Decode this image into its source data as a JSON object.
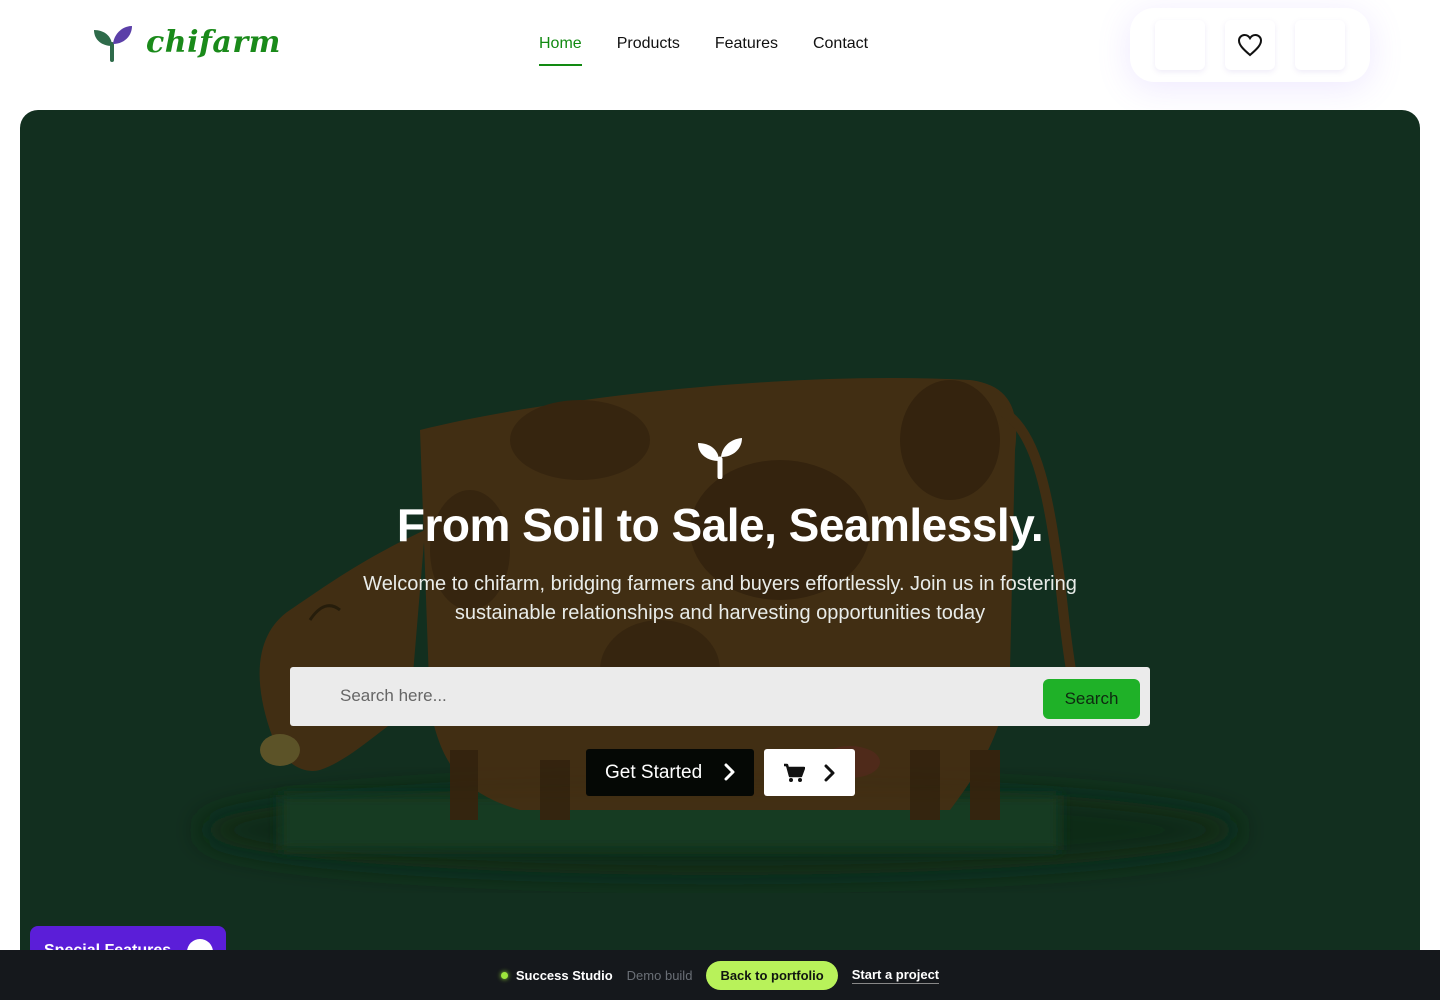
{
  "header": {
    "brand": "chifarm",
    "nav": [
      {
        "label": "Home",
        "active": true
      },
      {
        "label": "Products",
        "active": false
      },
      {
        "label": "Features",
        "active": false
      },
      {
        "label": "Contact",
        "active": false
      }
    ],
    "icons": [
      "blank-icon",
      "heart-icon",
      "blank-icon"
    ]
  },
  "hero": {
    "title": "From Soil to Sale, Seamlessly.",
    "subtitle": "Welcome to chifarm, bridging farmers and buyers effortlessly. Join us in fostering sustainable relationships and harvesting opportunities today",
    "search": {
      "placeholder": "Search here...",
      "button": "Search"
    },
    "get_started": "Get Started",
    "cart_icon": "cart-icon"
  },
  "floating_badge": {
    "label": "Special Features"
  },
  "bottom_bar": {
    "studio": "Success Studio",
    "demo": "Demo build",
    "back": "Back to portfolio",
    "project": "Start a project"
  },
  "colors": {
    "brand_green": "#1a8a1a",
    "hero_bg": "#122f1f",
    "search_button": "#1fb128",
    "badge_purple": "#5b1ed8",
    "bottom_accent": "#b8f25a"
  }
}
